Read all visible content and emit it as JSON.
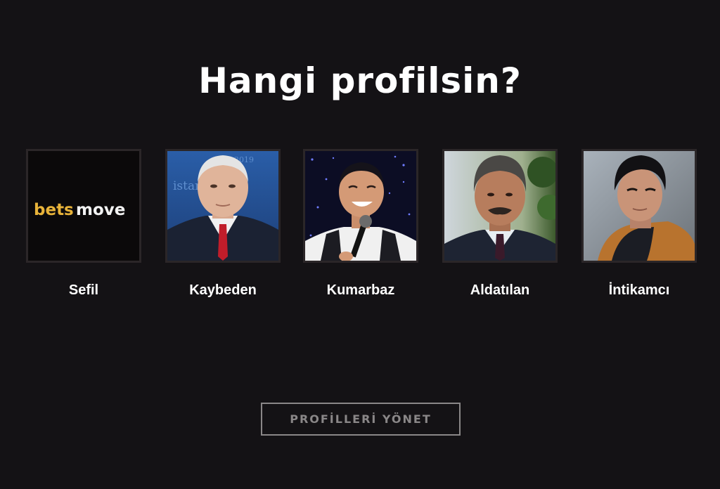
{
  "title": "Hangi profilsin?",
  "profiles": [
    {
      "name": "Sefil",
      "logo_part1": "bets",
      "logo_part2": "move"
    },
    {
      "name": "Kaybeden",
      "backdrop_text": "istan",
      "backdrop_year": "2019"
    },
    {
      "name": "Kumarbaz"
    },
    {
      "name": "Aldatılan"
    },
    {
      "name": "İntikamcı"
    }
  ],
  "manage_button": "PROFİLLERİ YÖNET",
  "colors": {
    "background": "#141215",
    "logo_gold": "#e8b33a",
    "button_border": "#8a8788"
  }
}
